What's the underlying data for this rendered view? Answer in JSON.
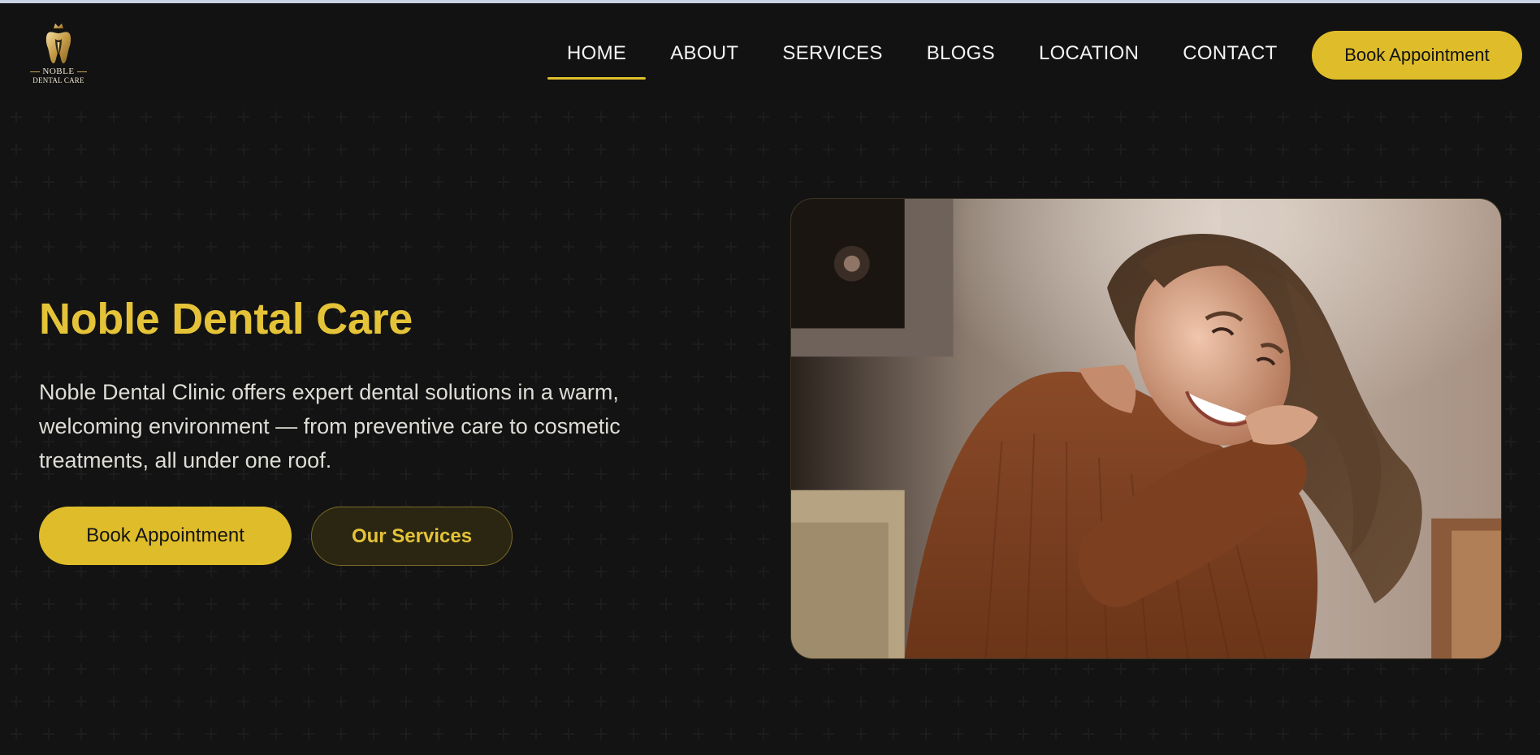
{
  "brand": {
    "logo_line1": "NOBLE",
    "logo_line2": "DENTAL CARE",
    "logo_icon": "tooth-crown-icon",
    "accent_color": "#dfbd2a",
    "background_color": "#121212"
  },
  "nav": {
    "items": [
      {
        "label": "HOME",
        "active": true
      },
      {
        "label": "ABOUT",
        "active": false
      },
      {
        "label": "SERVICES",
        "active": false
      },
      {
        "label": "BLOGS",
        "active": false
      },
      {
        "label": "LOCATION",
        "active": false
      },
      {
        "label": "CONTACT",
        "active": false
      }
    ],
    "cta_label": "Book Appointment"
  },
  "hero": {
    "title": "Noble Dental Care",
    "description": "Noble Dental Clinic offers expert dental solutions in a warm, welcoming environment — from preventive care to cosmetic treatments, all under one roof.",
    "primary_button": "Book Appointment",
    "secondary_button": "Our Services",
    "image_subject": "smiling-woman-photo"
  }
}
